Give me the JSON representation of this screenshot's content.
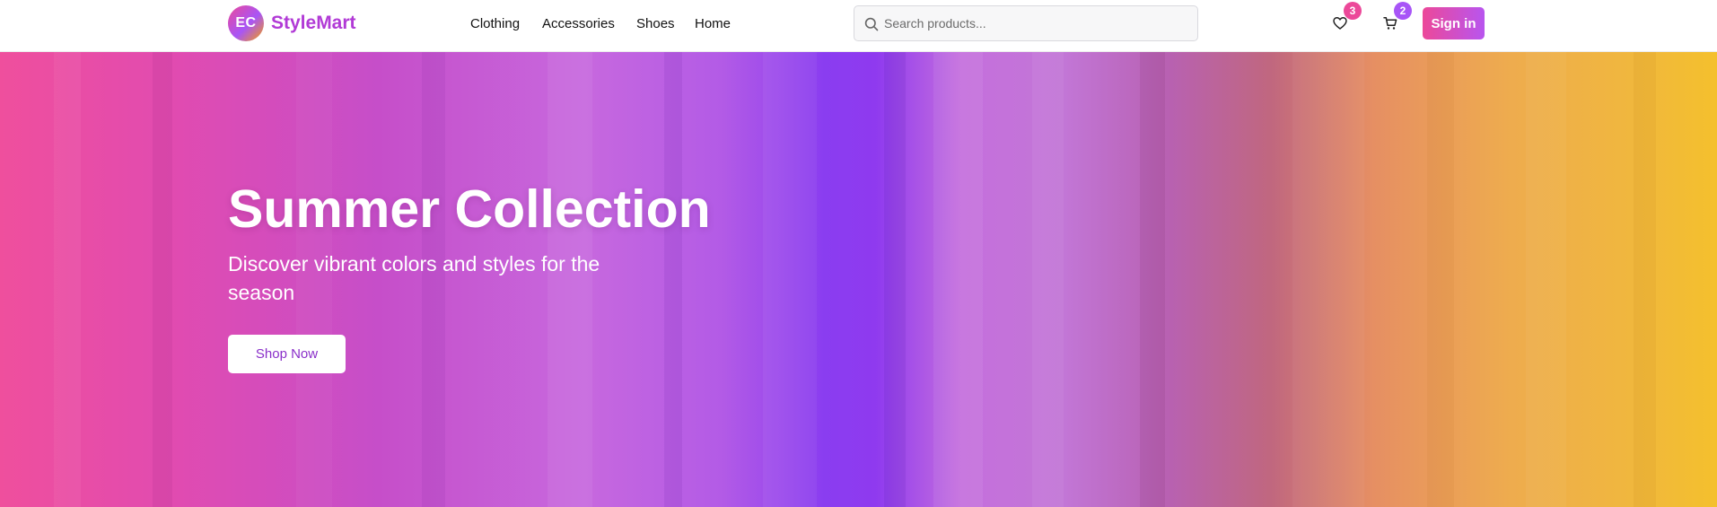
{
  "header": {
    "logo_initials": "EC",
    "brand_name": "StyleMart",
    "nav": [
      {
        "label": "Clothing"
      },
      {
        "label": "Accessories"
      },
      {
        "label": "Shoes"
      },
      {
        "label": "Home"
      }
    ],
    "search": {
      "placeholder": "Search products...",
      "value": "",
      "icon": "search-icon"
    },
    "wishlist": {
      "icon": "heart-icon",
      "count": "3",
      "badge_color": "#ec4899"
    },
    "cart": {
      "icon": "cart-icon",
      "count": "2",
      "badge_color": "#a855f7"
    },
    "signin_label": "Sign in"
  },
  "hero": {
    "title": "Summer Collection",
    "subtitle": "Discover vibrant colors and styles for the season",
    "cta_label": "Shop Now"
  },
  "colors": {
    "brand": "#b13ad6",
    "accent_pink": "#ec4899",
    "accent_purple": "#a855f7",
    "accent_amber": "#f59e0b"
  }
}
